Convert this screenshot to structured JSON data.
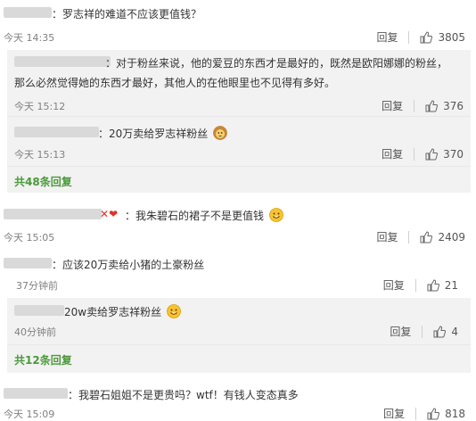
{
  "c1": {
    "text": "：罗志祥的难道不应该更值钱？",
    "time": "今天 14:35",
    "reply": "回复",
    "likes": "3805"
  },
  "c1_replies": [
    {
      "text_l1": "：对于粉丝来说，他的爱豆的东西才是最好的，既然是欧阳娜娜的粉丝，",
      "text_l2": "那么必然觉得她的东西才最好，其他人的在他眼里也不见得有多好。",
      "time": "今天 15:12",
      "reply": "回复",
      "likes": "376"
    },
    {
      "text": "：20万卖给罗志祥粉丝",
      "time": "今天 15:13",
      "reply": "回复",
      "likes": "370"
    }
  ],
  "c1_more": "共48条回复",
  "c2": {
    "text": "：我朱碧石的裙子不是更值钱",
    "time": "今天 15:05",
    "reply": "回复",
    "likes": "2409"
  },
  "c3": {
    "text": "：应该20万卖给小猪的土豪粉丝",
    "time": "37分钟前",
    "reply": "回复",
    "likes": "21"
  },
  "c3_replies": [
    {
      "text": "20w卖给罗志祥粉丝",
      "time": "40分钟前",
      "reply": "回复",
      "likes": "4"
    }
  ],
  "c3_more": "共12条回复",
  "c4": {
    "text": "：我碧石姐姐不是更贵吗？wtf！有钱人变态真多",
    "time": "今天 15:09",
    "reply": "回复",
    "likes": "818"
  },
  "colors": {
    "green": "#4a9a3a",
    "sub_bg": "#f2f2f2"
  },
  "icons": [
    "thumb-up-icon",
    "smile-emoji-icon",
    "lion-emoji-icon"
  ]
}
